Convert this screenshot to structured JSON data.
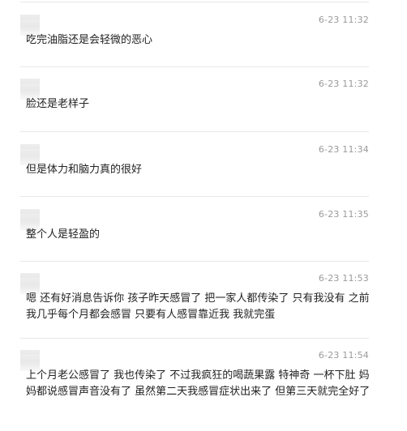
{
  "messages": [
    {
      "time": "6-23 11:32",
      "text": "吃完油脂还是会轻微的恶心"
    },
    {
      "time": "6-23 11:32",
      "text": "脸还是老样子"
    },
    {
      "time": "6-23 11:34",
      "text": "但是体力和脑力真的很好"
    },
    {
      "time": "6-23 11:35",
      "text": "整个人是轻盈的"
    },
    {
      "time": "6-23 11:53",
      "text": "嗯 还有好消息告诉你 孩子昨天感冒了 把一家人都传染了 只有我没有 之前我几乎每个月都会感冒 只要有人感冒靠近我 我就完蛋"
    },
    {
      "time": "6-23 11:54",
      "text": "上个月老公感冒了 我也传染了 不过我疯狂的喝蔬果露 特神奇 一杯下肚 妈妈都说感冒声音没有了 虽然第二天我感冒症状出来了 但第三天就完全好了"
    }
  ]
}
